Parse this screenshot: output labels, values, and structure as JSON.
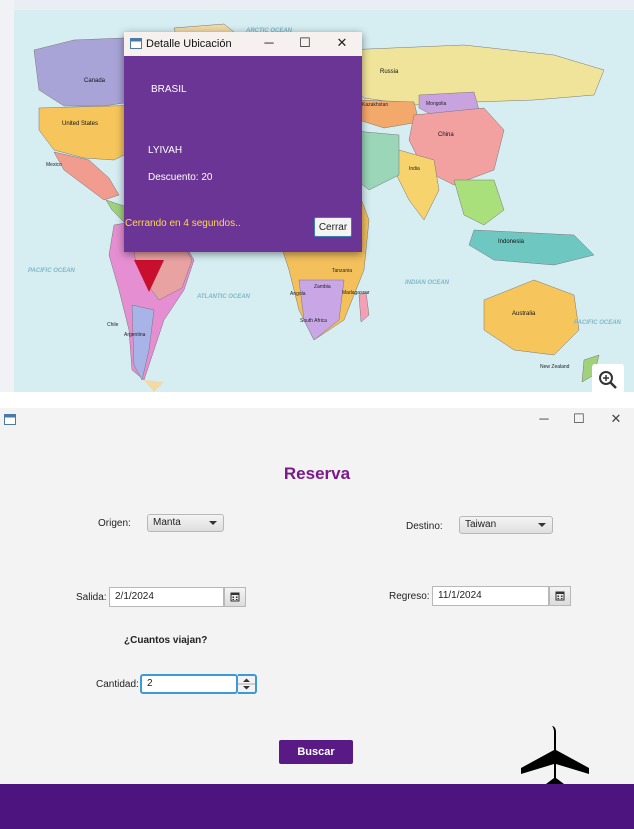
{
  "map_window": {
    "oceans": {
      "arctic": "ARCTIC OCEAN",
      "pacific_left": "PACIFIC OCEAN",
      "atlantic": "ATLANTIC OCEAN",
      "indian": "INDIAN OCEAN",
      "pacific_right": "PACIFIC OCEAN"
    },
    "countries": {
      "canada": "Canada",
      "usa": "United States",
      "mexico": "Mexico",
      "russia": "Russia",
      "mongolia": "Mongolia",
      "china": "China",
      "india": "India",
      "kazakhstan": "Kazakhstan",
      "indonesia": "Indonesia",
      "australia": "Australia",
      "new_zealand": "New Zealand",
      "argentina": "Argentina",
      "chile": "Chile",
      "angola": "Angola",
      "south_africa": "South Africa",
      "madagascar": "Madagascar",
      "zambia": "Zambia",
      "tanzania": "Tanzania"
    }
  },
  "popup": {
    "title": "Detalle Ubicación",
    "minimize": "─",
    "maximize": "☐",
    "close": "✕",
    "country": "BRASIL",
    "code": "LYIVAH",
    "discount": "Descuento: 20",
    "countdown": "Cerrando en 4 segundos..",
    "close_button": "Cerrar"
  },
  "reservation": {
    "title": "Reserva",
    "window_controls": {
      "minimize": "─",
      "maximize": "☐",
      "close": "✕"
    },
    "origen_label": "Origen:",
    "origen_value": "Manta",
    "destino_label": "Destino:",
    "destino_value": "Taiwan",
    "salida_label": "Salida:",
    "salida_value": "2/1/2024",
    "regreso_label": "Regreso:",
    "regreso_value": "11/1/2024",
    "question": "¿Cuantos viajan?",
    "cantidad_label": "Cantidad:",
    "cantidad_value": "2",
    "search_button": "Buscar"
  },
  "colors": {
    "popup_bg": "#6b3596",
    "title_purple": "#7a1a8a",
    "button_purple": "#5a1a86",
    "footer_purple": "#4d1480",
    "countdown_yellow": "#ffd84d"
  }
}
